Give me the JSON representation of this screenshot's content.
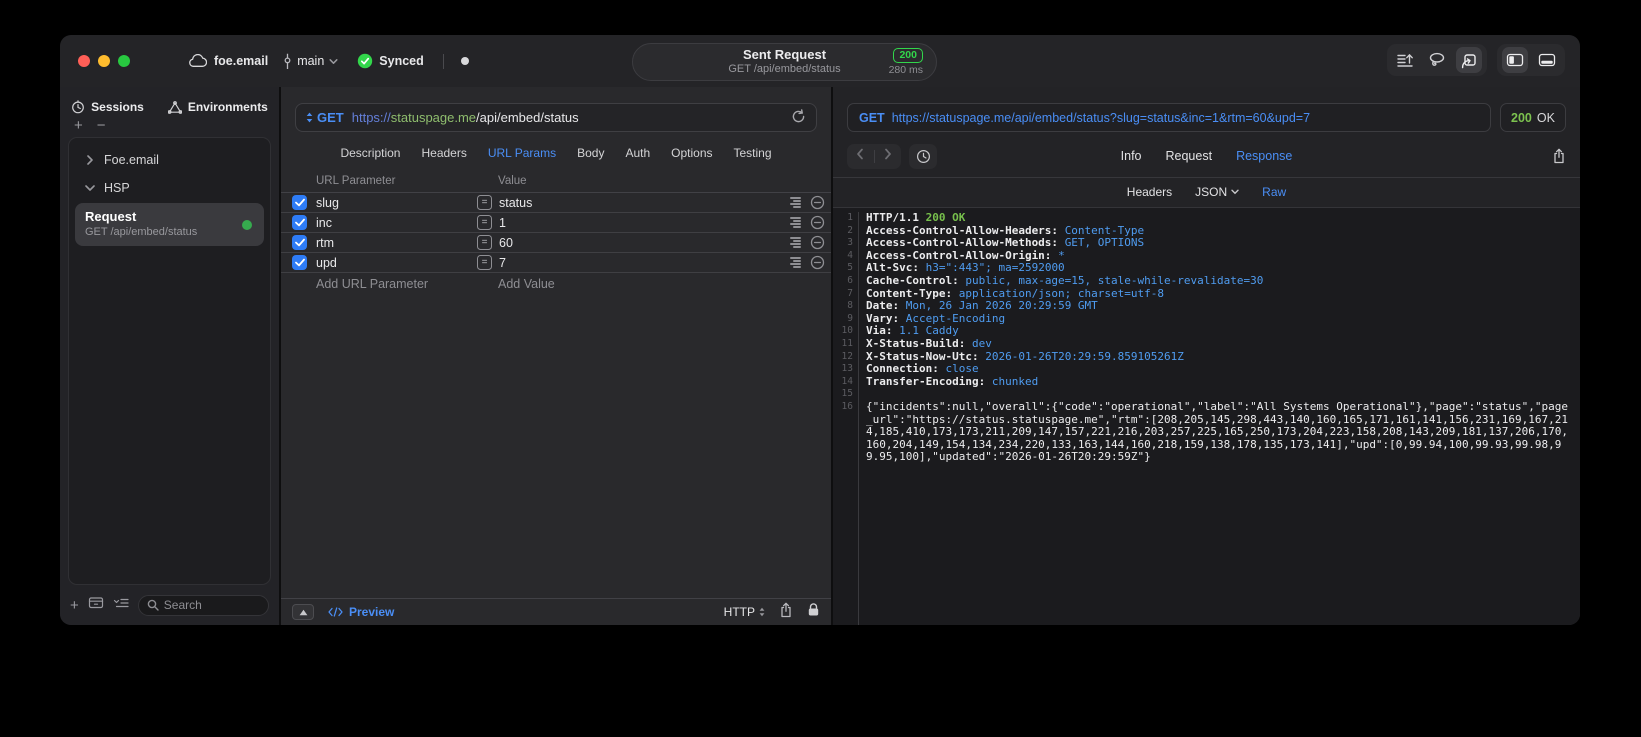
{
  "titlebar": {
    "project": "foe.email",
    "branch": "main",
    "sync_label": "Synced",
    "request_title": "Sent Request",
    "request_subtitle": "GET /api/embed/status",
    "status_badge": "200",
    "duration": "280 ms"
  },
  "sidebar": {
    "tabs": [
      {
        "label": "Sessions"
      },
      {
        "label": "Environments"
      }
    ],
    "tree_items": [
      {
        "label": "Foe.email",
        "expanded": false
      },
      {
        "label": "HSP",
        "expanded": true
      }
    ],
    "request_item": {
      "title": "Request",
      "subtitle": "GET /api/embed/status"
    },
    "search_placeholder": "Search"
  },
  "editor": {
    "method": "GET",
    "url": {
      "scheme": "https://",
      "host": "statuspage.me",
      "path": "/api/embed/status"
    },
    "tabs": [
      "Description",
      "Headers",
      "URL Params",
      "Body",
      "Auth",
      "Options",
      "Testing"
    ],
    "active_tab": "URL Params",
    "param_table": {
      "columns": [
        "URL Parameter",
        "Value"
      ],
      "rows": [
        {
          "enabled": true,
          "name": "slug",
          "value": "status"
        },
        {
          "enabled": true,
          "name": "inc",
          "value": "1"
        },
        {
          "enabled": true,
          "name": "rtm",
          "value": "60"
        },
        {
          "enabled": true,
          "name": "upd",
          "value": "7"
        }
      ],
      "add_name_placeholder": "Add URL Parameter",
      "add_value_placeholder": "Add Value"
    },
    "footer": {
      "preview_label": "Preview",
      "protocol_label": "HTTP"
    }
  },
  "response": {
    "method": "GET",
    "url": "https://statuspage.me/api/embed/status?slug=status&inc=1&rtm=60&upd=7",
    "status_code": "200",
    "status_text": "OK",
    "tabs": [
      "Info",
      "Request",
      "Response"
    ],
    "active_tab": "Response",
    "subtabs": [
      "Headers",
      "JSON",
      "Raw"
    ],
    "active_subtab": "Raw",
    "dropdown_subtab": "JSON",
    "status_line": {
      "protocol": "HTTP/1.1",
      "status": "200 OK"
    },
    "headers": [
      {
        "name": "Access-Control-Allow-Headers",
        "value": "Content-Type"
      },
      {
        "name": "Access-Control-Allow-Methods",
        "value": "GET, OPTIONS"
      },
      {
        "name": "Access-Control-Allow-Origin",
        "value": "*"
      },
      {
        "name": "Alt-Svc",
        "value": "h3=\":443\"; ma=2592000"
      },
      {
        "name": "Cache-Control",
        "value": "public, max-age=15, stale-while-revalidate=30"
      },
      {
        "name": "Content-Type",
        "value": "application/json; charset=utf-8"
      },
      {
        "name": "Date",
        "value": "Mon, 26 Jan 2026 20:29:59 GMT"
      },
      {
        "name": "Vary",
        "value": "Accept-Encoding"
      },
      {
        "name": "Via",
        "value": "1.1 Caddy"
      },
      {
        "name": "X-Status-Build",
        "value": "dev"
      },
      {
        "name": "X-Status-Now-Utc",
        "value": "2026-01-26T20:29:59.859105261Z"
      },
      {
        "name": "Connection",
        "value": "close"
      },
      {
        "name": "Transfer-Encoding",
        "value": "chunked"
      }
    ],
    "body": "{\"incidents\":null,\"overall\":{\"code\":\"operational\",\"label\":\"All Systems Operational\"},\"page\":\"status\",\"page_url\":\"https://status.statuspage.me\",\"rtm\":[208,205,145,298,443,140,160,165,171,161,141,156,231,169,167,214,185,410,173,173,211,209,147,157,221,216,203,257,225,165,250,173,204,223,158,208,143,209,181,137,206,170,160,204,149,154,134,234,220,133,163,144,160,218,159,138,178,135,173,141],\"upd\":[0,99.94,100,99.93,99.98,99.95,100],\"updated\":\"2026-01-26T20:29:59Z\"}"
  },
  "colors": {
    "accent_blue": "#4a8ef5",
    "success_green": "#32d74b",
    "code_value_blue": "#4f9cf0",
    "code_status_green": "#77c04c",
    "checkbox_blue": "#2e7cf6",
    "url_host_green": "#8fbe6e"
  }
}
